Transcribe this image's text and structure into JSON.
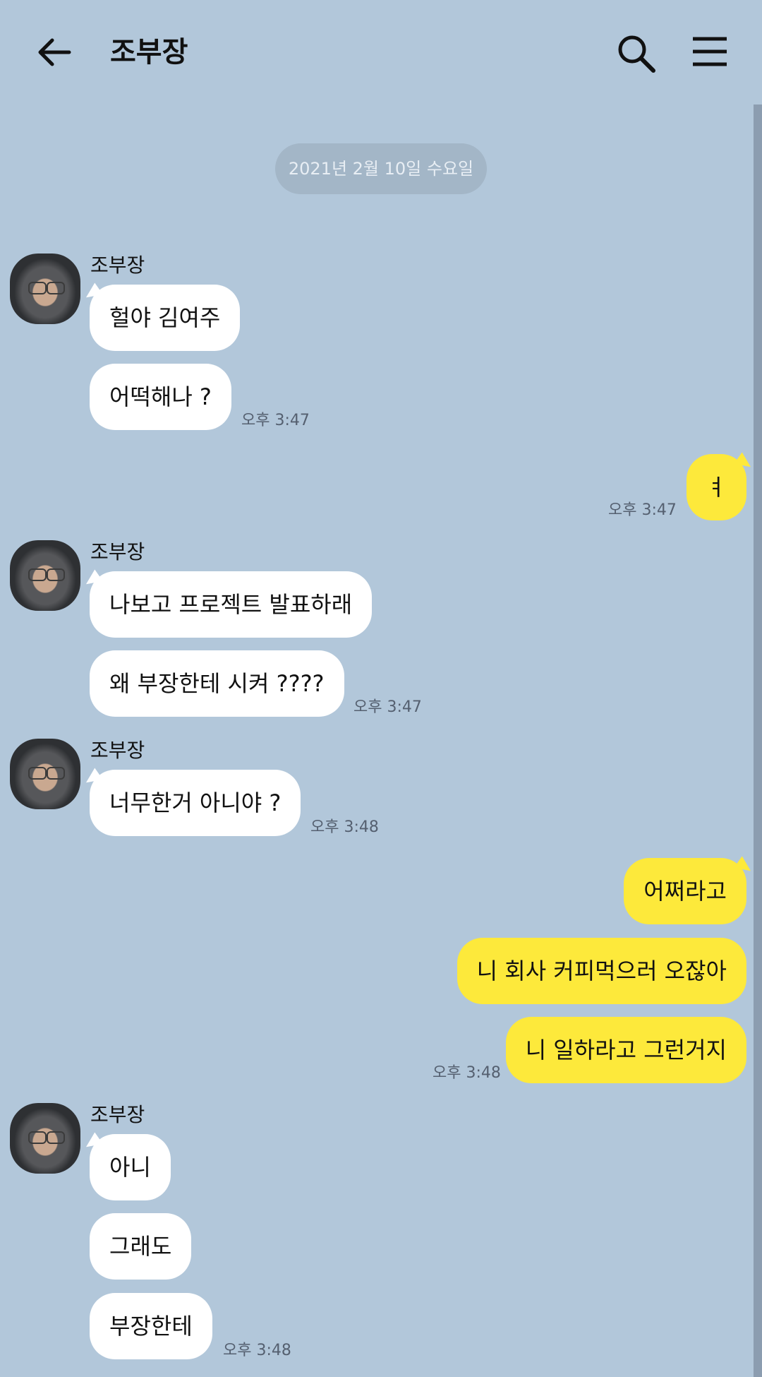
{
  "header": {
    "title": "조부장",
    "back_icon": "arrow-left-icon",
    "search_icon": "search-icon",
    "menu_icon": "hamburger-menu-icon"
  },
  "date_divider": "2021년 2월 10일 수요일",
  "sender": "조부장",
  "messages": {
    "g1": {
      "name": "조부장",
      "m1": "헐야 김여주",
      "m2": "어떡해나 ?",
      "time": "오후 3:47"
    },
    "o1": {
      "m1": "ㅕ",
      "time": "오후 3:47"
    },
    "g2": {
      "name": "조부장",
      "m1": "나보고 프로젝트 발표하래",
      "m2": "왜 부장한테 시켜 ????",
      "time": "오후 3:47"
    },
    "g3": {
      "name": "조부장",
      "m1": "너무한거 아니야 ?",
      "time": "오후 3:48"
    },
    "o2": {
      "m1": "어쩌라고",
      "m2": "니 회사 커피먹으러 오잖아",
      "m3": "니 일하라고 그런거지",
      "time": "오후 3:48"
    },
    "g4": {
      "name": "조부장",
      "m1": "아니",
      "m2": "그래도",
      "m3": "부장한테",
      "time": "오후 3:48"
    }
  },
  "colors": {
    "background": "#b2c7da",
    "incoming_bubble": "#ffffff",
    "outgoing_bubble": "#fde93b",
    "date_pill": "#a3b6c7"
  }
}
